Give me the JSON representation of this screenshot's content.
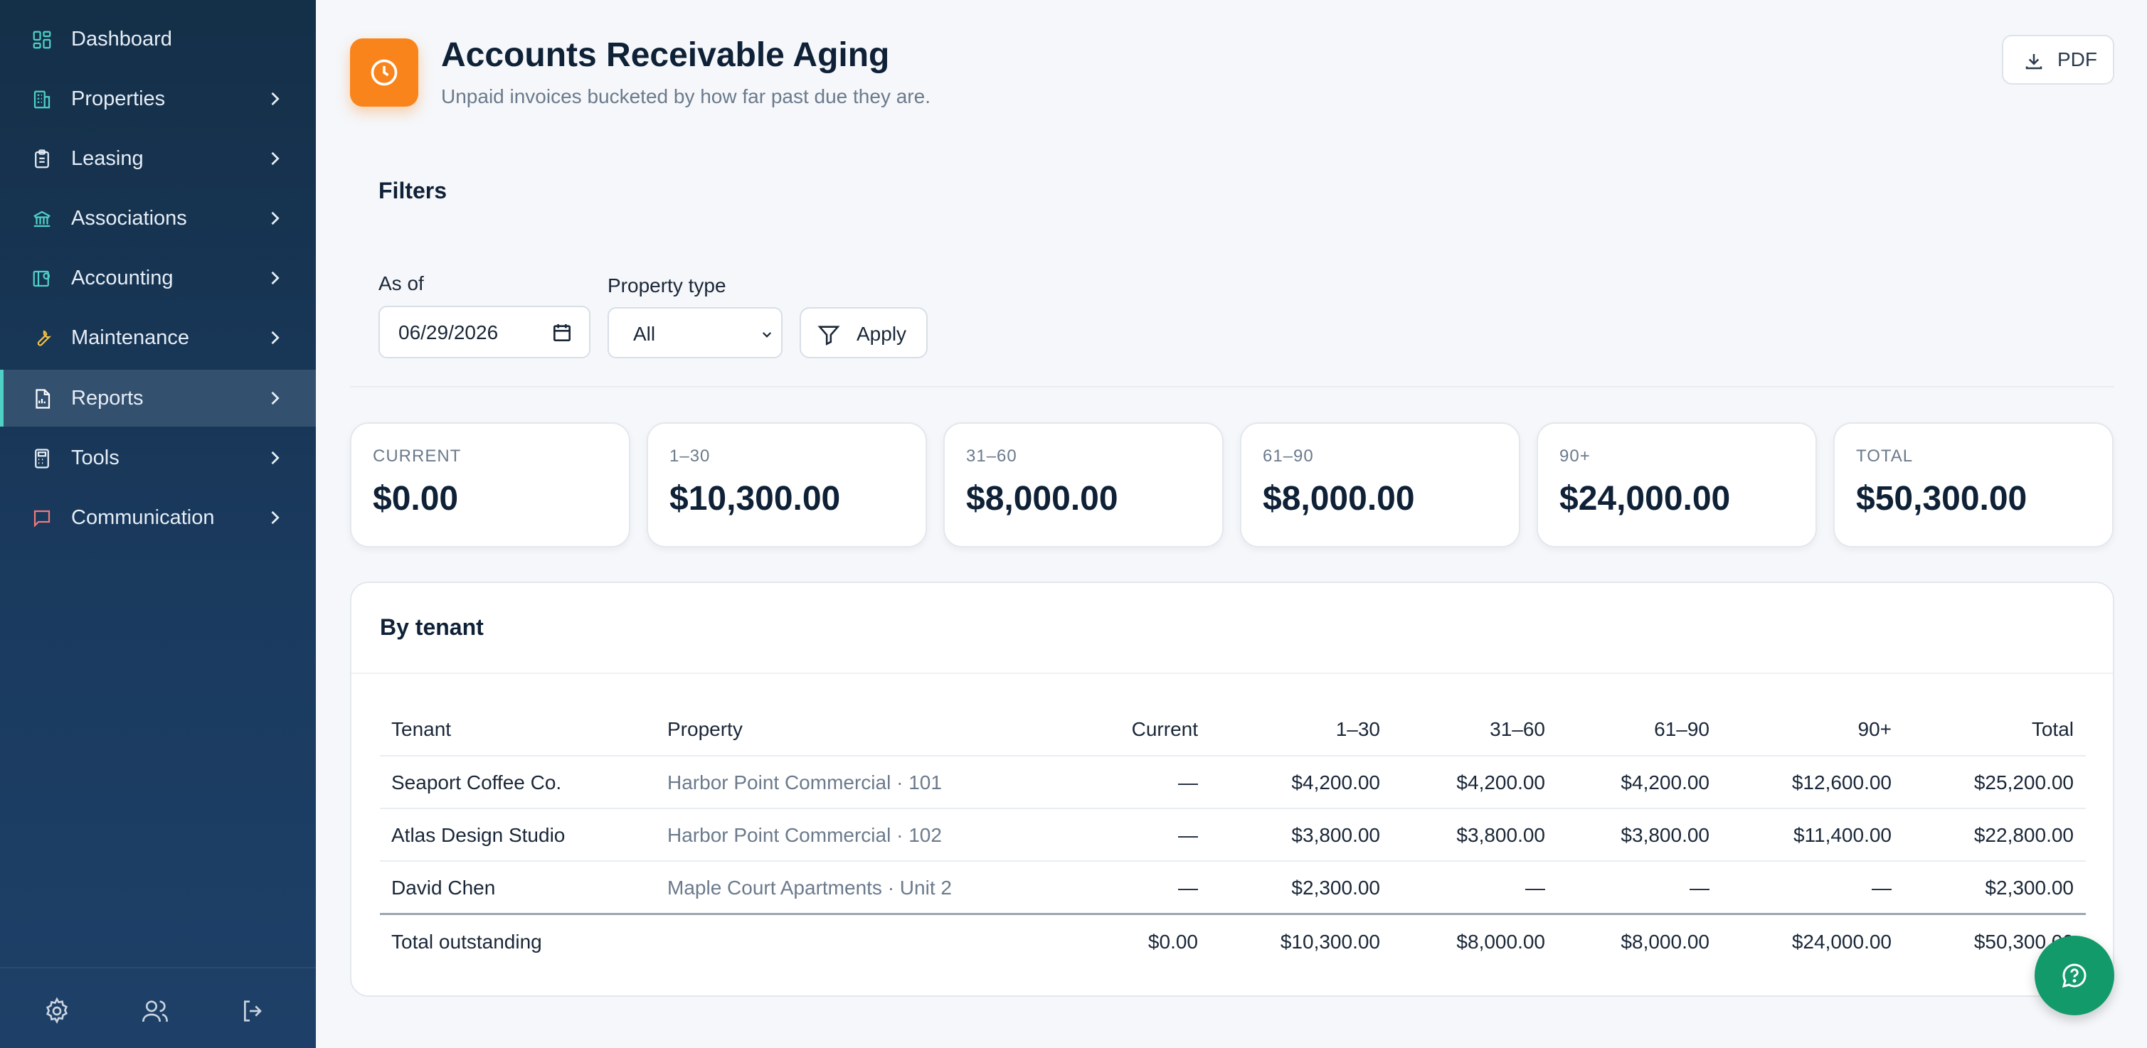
{
  "sidebar": {
    "items": [
      {
        "label": "Dashboard",
        "icon": "dashboard-icon",
        "chevron": false
      },
      {
        "label": "Properties",
        "icon": "building-icon",
        "chevron": true
      },
      {
        "label": "Leasing",
        "icon": "clipboard-icon",
        "chevron": true
      },
      {
        "label": "Associations",
        "icon": "bank-icon",
        "chevron": true
      },
      {
        "label": "Accounting",
        "icon": "ledger-icon",
        "chevron": true
      },
      {
        "label": "Maintenance",
        "icon": "wrench-icon",
        "chevron": true
      },
      {
        "label": "Reports",
        "icon": "report-icon",
        "chevron": true,
        "active": true
      },
      {
        "label": "Tools",
        "icon": "calculator-icon",
        "chevron": true
      },
      {
        "label": "Communication",
        "icon": "chat-icon",
        "chevron": true
      }
    ],
    "footer_icons": [
      "gear-icon",
      "users-icon",
      "logout-icon"
    ]
  },
  "header": {
    "icon": "clock-icon",
    "title": "Accounts Receivable Aging",
    "subtitle": "Unpaid invoices bucketed by how far past due they are.",
    "pdf_label": "PDF"
  },
  "filters": {
    "title": "Filters",
    "as_of_label": "As of",
    "as_of_value": "06/29/2026",
    "property_type_label": "Property type",
    "property_type_value": "All",
    "apply_label": "Apply"
  },
  "summary": [
    {
      "label": "CURRENT",
      "value": "$0.00"
    },
    {
      "label": "1–30",
      "value": "$10,300.00"
    },
    {
      "label": "31–60",
      "value": "$8,000.00"
    },
    {
      "label": "61–90",
      "value": "$8,000.00"
    },
    {
      "label": "90+",
      "value": "$24,000.00"
    },
    {
      "label": "TOTAL",
      "value": "$50,300.00"
    }
  ],
  "table": {
    "title": "By tenant",
    "columns": [
      "Tenant",
      "Property",
      "Current",
      "1–30",
      "31–60",
      "61–90",
      "90+",
      "Total"
    ],
    "rows": [
      [
        "Seaport Coffee Co.",
        "Harbor Point Commercial · 101",
        "—",
        "$4,200.00",
        "$4,200.00",
        "$4,200.00",
        "$12,600.00",
        "$25,200.00"
      ],
      [
        "Atlas Design Studio",
        "Harbor Point Commercial · 102",
        "—",
        "$3,800.00",
        "$3,800.00",
        "$3,800.00",
        "$11,400.00",
        "$22,800.00"
      ],
      [
        "David Chen",
        "Maple Court Apartments · Unit 2",
        "—",
        "$2,300.00",
        "—",
        "—",
        "—",
        "$2,300.00"
      ]
    ],
    "total_row": [
      "Total outstanding",
      "",
      "$0.00",
      "$10,300.00",
      "$8,000.00",
      "$8,000.00",
      "$24,000.00",
      "$50,300.00"
    ]
  },
  "colors": {
    "sidebar_top": "#142f48",
    "sidebar_bottom": "#1e4068",
    "accent_teal": "#4fd1c5",
    "header_badge": "#f9841b",
    "chat_fab": "#139a6b"
  }
}
